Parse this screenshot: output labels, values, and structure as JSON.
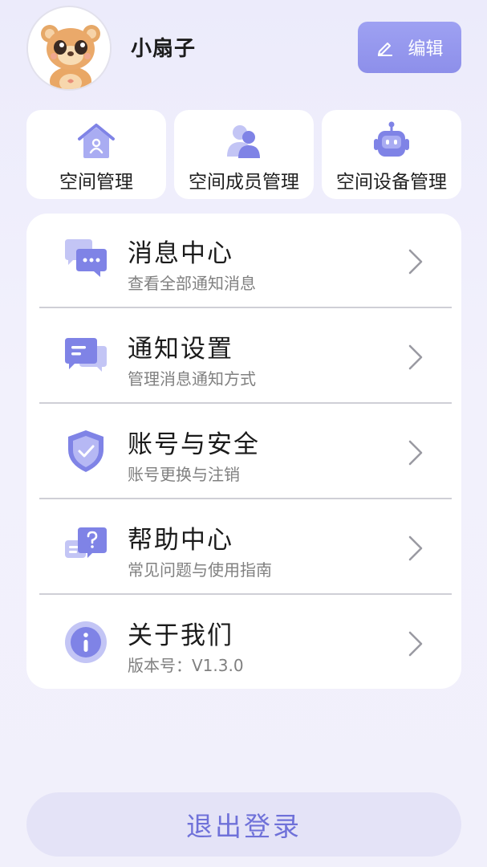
{
  "profile": {
    "username": "小扇子",
    "edit_label": "编辑"
  },
  "quick_actions": [
    {
      "label": "空间管理",
      "icon": "house-user-icon"
    },
    {
      "label": "空间成员管理",
      "icon": "members-icon"
    },
    {
      "label": "空间设备管理",
      "icon": "robot-device-icon"
    }
  ],
  "menu": [
    {
      "title": "消息中心",
      "subtitle": "查看全部通知消息",
      "icon": "message-bubbles-icon"
    },
    {
      "title": "通知设置",
      "subtitle": "管理消息通知方式",
      "icon": "notification-settings-icon"
    },
    {
      "title": "账号与安全",
      "subtitle": "账号更换与注销",
      "icon": "shield-check-icon"
    },
    {
      "title": "帮助中心",
      "subtitle": "常见问题与使用指南",
      "icon": "help-question-icon"
    },
    {
      "title": "关于我们",
      "subtitle": "版本号：V1.3.0",
      "icon": "info-icon"
    }
  ],
  "logout_label": "退出登录",
  "colors": {
    "accent": "#8d8fea",
    "icon_purple": "#7f83e6",
    "logout_text": "#6f71d9",
    "logout_bg": "#e4e3f7"
  }
}
